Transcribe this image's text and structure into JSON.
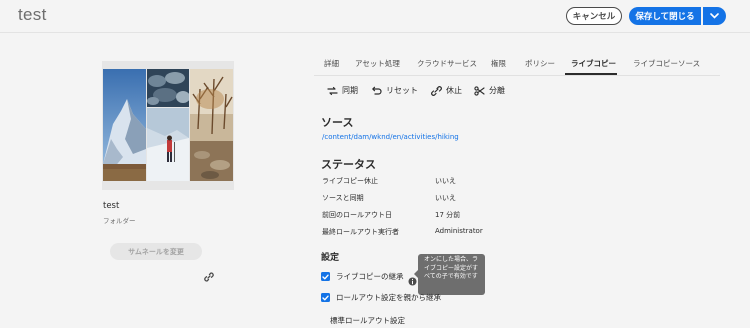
{
  "header": {
    "title": "test",
    "cancel_label": "キャンセル",
    "save_label": "保存して閉じる"
  },
  "asset": {
    "name": "test",
    "type": "フォルダー",
    "change_thumbnail_label": "サムネールを変更"
  },
  "tabs": [
    {
      "label": "詳細"
    },
    {
      "label": "アセット処理"
    },
    {
      "label": "クラウドサービス"
    },
    {
      "label": "権限"
    },
    {
      "label": "ポリシー"
    },
    {
      "label": "ライブコピー",
      "active": true
    },
    {
      "label": "ライブコピーソース"
    }
  ],
  "actions": {
    "sync": "同期",
    "reset": "リセット",
    "suspend": "休止",
    "detach": "分離"
  },
  "source": {
    "heading": "ソース",
    "path": "/content/dam/wknd/en/activities/hiking"
  },
  "status": {
    "heading": "ステータス",
    "rows": [
      {
        "label": "ライブコピー休止",
        "value": "いいえ"
      },
      {
        "label": "ソースと同期",
        "value": "いいえ"
      },
      {
        "label": "前回のロールアウト日",
        "value": "17 分前"
      },
      {
        "label": "最終ロールアウト実行者",
        "value": "Administrator"
      }
    ]
  },
  "settings": {
    "heading": "設定",
    "inherit_label": "ライブコピーの継承",
    "rollout_inherit_label": "ロールアウト設定を親から継承",
    "tooltip": "オンにした場合、ライブコピー設定がすべての子で有効です",
    "standard_rollout_label": "標準ロールアウト設定"
  },
  "colors": {
    "accent": "#1473e6",
    "text": "#2c2c2c",
    "background": "#f4f4f4"
  }
}
